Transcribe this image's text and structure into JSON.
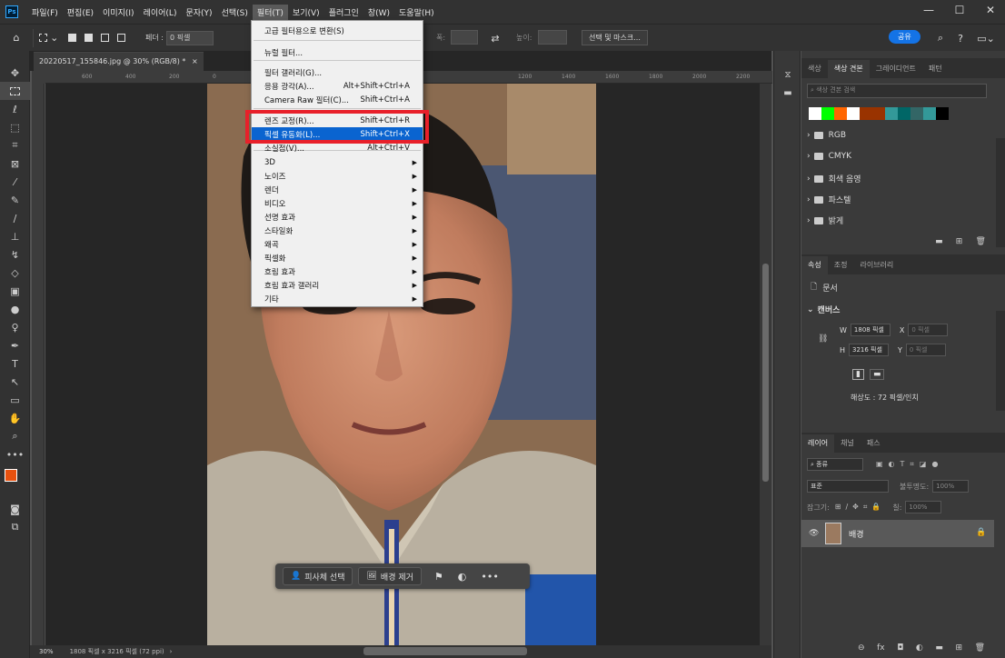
{
  "menubar": {
    "logo": "Ps",
    "items": [
      "파일(F)",
      "편집(E)",
      "이미지(I)",
      "레이어(L)",
      "문자(Y)",
      "선택(S)",
      "필터(T)",
      "보기(V)",
      "플러그인",
      "창(W)",
      "도움말(H)"
    ],
    "active_index": 6,
    "window_controls": [
      "minimize",
      "maximize",
      "close"
    ]
  },
  "options_bar": {
    "feather_label": "페더 :",
    "feather_value": "0 픽셀",
    "width_label": "폭:",
    "height_label": "높이:",
    "select_mask_button": "선택 및 마스크...",
    "share_button": "공유"
  },
  "document": {
    "tab_title": "20220517_155846.jpg @ 30% (RGB/8) *",
    "ruler_labels": [
      "600",
      "400",
      "200",
      "0",
      "",
      "",
      "",
      "",
      "",
      "",
      "1200",
      "1400",
      "1600",
      "1800",
      "2000",
      "2200",
      "2400"
    ],
    "zoom": "30%",
    "status_info": "1808 픽셀 x 3216 픽셀 (72 ppi)"
  },
  "filter_menu": {
    "items": [
      {
        "label": "고급 필터용으로 변환(S)",
        "shortcut": "",
        "submenu": false
      },
      {
        "label": "뉴럴 필터...",
        "shortcut": "",
        "submenu": false
      },
      {
        "label": "필터 갤러리(G)...",
        "shortcut": "",
        "submenu": false
      },
      {
        "label": "응용 광각(A)...",
        "shortcut": "Alt+Shift+Ctrl+A",
        "submenu": false
      },
      {
        "label": "Camera Raw 필터(C)...",
        "shortcut": "Shift+Ctrl+A",
        "submenu": false
      },
      {
        "label": "렌즈 교정(R)...",
        "shortcut": "Shift+Ctrl+R",
        "submenu": false
      },
      {
        "label": "픽셀 유동화(L)...",
        "shortcut": "Shift+Ctrl+X",
        "submenu": false,
        "highlighted": true
      },
      {
        "label": "소실점(V)...",
        "shortcut": "Alt+Ctrl+V",
        "submenu": false
      },
      {
        "label": "3D",
        "shortcut": "",
        "submenu": true
      },
      {
        "label": "노이즈",
        "shortcut": "",
        "submenu": true
      },
      {
        "label": "렌더",
        "shortcut": "",
        "submenu": true
      },
      {
        "label": "비디오",
        "shortcut": "",
        "submenu": true
      },
      {
        "label": "선명 효과",
        "shortcut": "",
        "submenu": true
      },
      {
        "label": "스타일화",
        "shortcut": "",
        "submenu": true
      },
      {
        "label": "왜곡",
        "shortcut": "",
        "submenu": true
      },
      {
        "label": "픽셀화",
        "shortcut": "",
        "submenu": true
      },
      {
        "label": "흐림 효과",
        "shortcut": "",
        "submenu": true
      },
      {
        "label": "흐림 효과 갤러리",
        "shortcut": "",
        "submenu": true
      },
      {
        "label": "기타",
        "shortcut": "",
        "submenu": true
      }
    ]
  },
  "context_bar": {
    "select_subject": "피사체 선택",
    "remove_bg": "배경 제거",
    "more": "•••"
  },
  "swatches_panel": {
    "tabs": [
      "색상",
      "색상 견본",
      "그레이디언트",
      "패턴"
    ],
    "active_tab": 1,
    "search_placeholder": "색상 견본 검색",
    "colors": [
      "#ffffff",
      "#00ff00",
      "#ff6600",
      "#ffffff",
      "#993300",
      "#993300",
      "#339999",
      "#006666",
      "#336666",
      "#339999",
      "#000000"
    ],
    "groups": [
      "RGB",
      "CMYK",
      "회색 음영",
      "파스텔",
      "밝게"
    ]
  },
  "properties_panel": {
    "tabs": [
      "속성",
      "조정",
      "라이브러리"
    ],
    "active_tab": 0,
    "doc_label": "문서",
    "section": "캔버스",
    "w_label": "W",
    "w_value": "1808 픽셀",
    "h_label": "H",
    "h_value": "3216 픽셀",
    "x_label": "X",
    "x_value": "0 픽셀",
    "y_label": "Y",
    "y_value": "0 픽셀",
    "resolution": "해상도 : 72 픽셀/인치"
  },
  "layers_panel": {
    "tabs": [
      "레이어",
      "채널",
      "패스"
    ],
    "active_tab": 0,
    "filter_kind": "종류",
    "blend_mode": "표준",
    "opacity_label": "불투명도:",
    "opacity_value": "100%",
    "lock_label": "잠그기:",
    "fill_label": "칠:",
    "fill_value": "100%",
    "layer_name": "배경"
  }
}
